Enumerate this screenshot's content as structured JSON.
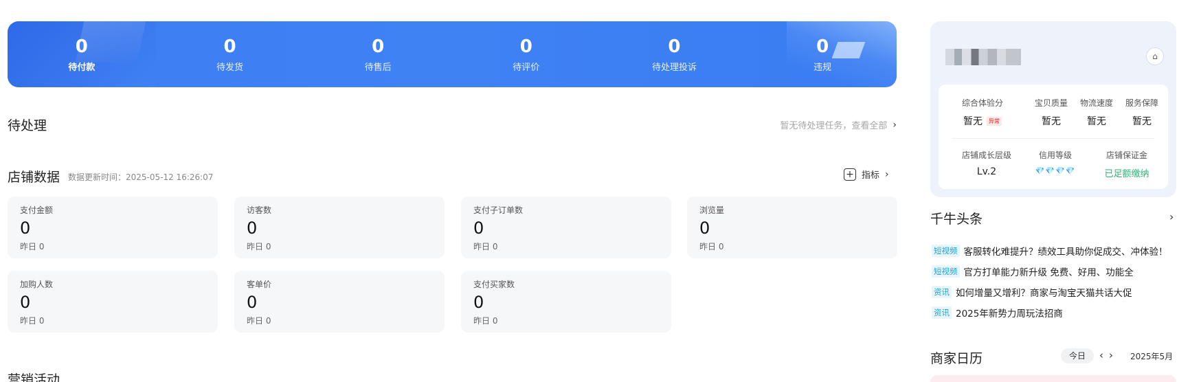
{
  "banner": {
    "stats": [
      {
        "value": "0",
        "label": "待付款"
      },
      {
        "value": "0",
        "label": "待发货"
      },
      {
        "value": "0",
        "label": "待售后"
      },
      {
        "value": "0",
        "label": "待评价"
      },
      {
        "value": "0",
        "label": "待处理投诉"
      },
      {
        "value": "0",
        "label": "违规"
      }
    ]
  },
  "pending": {
    "title": "待处理",
    "link": "暂无待处理任务，查看全部"
  },
  "shop_data": {
    "title": "店铺数据",
    "update_time": "数据更新时间：2025-05-12 16:26:07",
    "indicator_label": "指标",
    "cards": [
      {
        "title": "支付金额",
        "value": "0",
        "yesterday": "昨日 0"
      },
      {
        "title": "访客数",
        "value": "0",
        "yesterday": "昨日 0"
      },
      {
        "title": "支付子订单数",
        "value": "0",
        "yesterday": "昨日 0"
      },
      {
        "title": "浏览量",
        "value": "0",
        "yesterday": "昨日 0"
      },
      {
        "title": "加购人数",
        "value": "0",
        "yesterday": "昨日 0"
      },
      {
        "title": "客单价",
        "value": "0",
        "yesterday": "昨日 0"
      },
      {
        "title": "支付买家数",
        "value": "0",
        "yesterday": "昨日 0"
      }
    ]
  },
  "marketing": {
    "title": "营销活动"
  },
  "shop_panel": {
    "metrics": [
      {
        "label": "综合体验分",
        "value": "暂无",
        "badge": "异常"
      },
      {
        "label": "宝贝质量",
        "value": "暂无"
      },
      {
        "label": "物流速度",
        "value": "暂无"
      },
      {
        "label": "服务保障",
        "value": "暂无"
      },
      {
        "label": "店铺成长层级",
        "value": "Lv.2"
      },
      {
        "label": "信用等级",
        "value": "💎💎💎💎"
      },
      {
        "label": "店铺保证金",
        "value": "已足额缴纳"
      }
    ]
  },
  "news": {
    "title": "千牛头条",
    "items": [
      {
        "tag": "短视频",
        "text": "客服转化难提升？绩效工具助你促成交、冲体验！"
      },
      {
        "tag": "短视频",
        "text": "官方打单能力新升级 免费、好用、功能全"
      },
      {
        "tag": "资讯",
        "text": "如何增量又增利？商家与淘宝天猫共话大促"
      },
      {
        "tag": "资讯",
        "text": "2025年新势力周玩法招商"
      }
    ]
  },
  "calendar": {
    "title": "商家日历",
    "today_label": "今日",
    "prev": "‹",
    "next": "›",
    "month": "2025年5月"
  },
  "colors": {
    "banner_blue": "#3f82f4",
    "tag_blue": "#1f9fd8",
    "abnormal_red": "#e02020",
    "deposit_green": "#2bb673"
  }
}
